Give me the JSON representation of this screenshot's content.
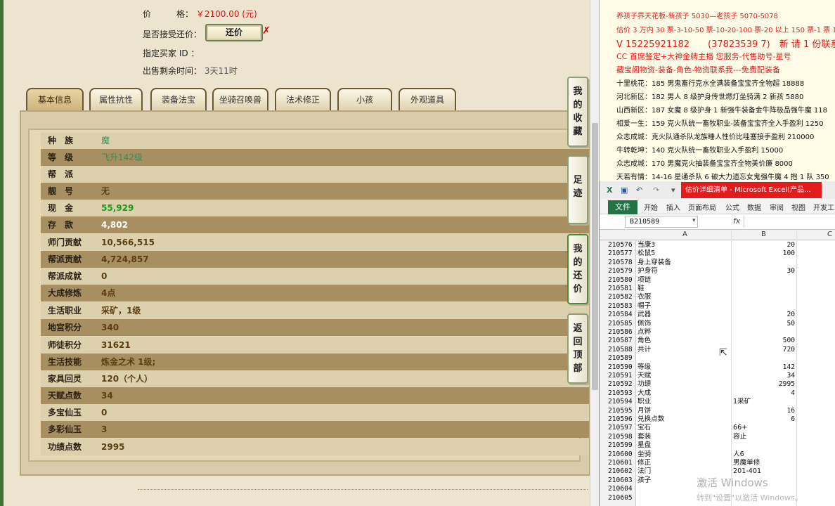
{
  "game": {
    "price_label": "价　　　格：",
    "price_value": "￥2100.00 (元)",
    "counter_label": "是否接受还价：",
    "counter_button": "还价",
    "buyer_label": "指定买家 ID ：",
    "time_label": "出售剩余时间：",
    "time_value": "3天11时",
    "tabs": [
      "基本信息",
      "属性抗性",
      "装备法宝",
      "坐骑召唤兽",
      "法术修正",
      "小孩",
      "外观道具"
    ],
    "stats": [
      {
        "k": "种　族",
        "v": "魔"
      },
      {
        "k": "等　级",
        "v": "飞升142级"
      },
      {
        "k": "帮　派",
        "v": ""
      },
      {
        "k": "靓　号",
        "v": "无"
      },
      {
        "k": "现　金",
        "v": "55,929"
      },
      {
        "k": "存　款",
        "v": "4,802"
      },
      {
        "k": "师门贡献",
        "v": "10,566,515"
      },
      {
        "k": "帮派贡献",
        "v": "4,724,857"
      },
      {
        "k": "帮派成就",
        "v": "0"
      },
      {
        "k": "大成修炼",
        "v": "4点"
      },
      {
        "k": "生活职业",
        "v": "采矿，1级"
      },
      {
        "k": "地宫积分",
        "v": "340"
      },
      {
        "k": "师徒积分",
        "v": "31621"
      },
      {
        "k": "生活技能",
        "v": "炼金之术 1级;"
      },
      {
        "k": "家具回灵",
        "v": "120（个人）"
      },
      {
        "k": "天赋点数",
        "v": "34"
      },
      {
        "k": "多宝仙玉",
        "v": "0"
      },
      {
        "k": "多彩仙玉",
        "v": "3"
      },
      {
        "k": "功绩点数",
        "v": "2995"
      }
    ],
    "side_buttons": [
      "我的收藏",
      "足迹",
      "我的还价",
      "返回顶部"
    ]
  },
  "doc": {
    "lines_red": [
      "养孩子界天花板-新孩子 5030—老孩子 5070-5078",
      "估价 3 万内 30 票-3-10-50 票-10-20-100 票-20 以上 150 票-1 票 1",
      "V 15225921182　　(37823539 7)　新 请 1 份联系",
      "CC 首席鉴定+大神金牌主播  您服务-代售助号-星号",
      "藏宝阁物资-装备-角色-物资联系我---免费配装备"
    ],
    "lines_black": [
      "十里桃花：185 男鬼畜行克水全满装备宝宝齐全物超 18888",
      "河北新区：182 男人 8 级护身传世燃灯坐骑满 2 新孩 5880",
      "山西新区：187 女魔 8 级护身 1 新强牛装备金牛阵极品强牛魔 118",
      "相爱一生：159 克火队统一畜牧职业-装备宝宝齐全入手盈利 1250",
      "众志成城：克火队通杀队龙族睡人性价比哇塞接手盈利 210000",
      "牛转乾坤：140 克火队统一畜牧职业入手盈利 15000",
      "众志成城：170 男魔克火抽装备宝宝齐全物美价廉 8000",
      "天若有情：14-16 星通杀队 6 破大力遗忘女鬼强牛魔 4 抱 1 队 350"
    ]
  },
  "excel": {
    "title": "估价详细清单 - Microsoft Excel(产品...",
    "file_tab": "文件",
    "ribbon_tabs": [
      "开始",
      "插入",
      "页面布局",
      "公式",
      "数据",
      "审阅",
      "视图",
      "开发工"
    ],
    "namebox": "B210589",
    "fx": "fx",
    "columns": [
      "A",
      "B",
      "C"
    ],
    "rows": [
      {
        "n": "210576",
        "a": "当康3",
        "b": "20"
      },
      {
        "n": "210577",
        "a": "松鼠5",
        "b": "100"
      },
      {
        "n": "210578",
        "a": "身上穿装备",
        "b": ""
      },
      {
        "n": "210579",
        "a": "护身符",
        "b": "30"
      },
      {
        "n": "210580",
        "a": "项链",
        "b": ""
      },
      {
        "n": "210581",
        "a": "鞋",
        "b": ""
      },
      {
        "n": "210582",
        "a": "衣服",
        "b": ""
      },
      {
        "n": "210583",
        "a": "帽子",
        "b": ""
      },
      {
        "n": "210584",
        "a": "武器",
        "b": "20"
      },
      {
        "n": "210585",
        "a": "佩饰",
        "b": "50"
      },
      {
        "n": "210586",
        "a": "点粹",
        "b": ""
      },
      {
        "n": "210587",
        "a": "角色",
        "b": "500"
      },
      {
        "n": "210588",
        "a": "共计",
        "b": "720"
      },
      {
        "n": "210589",
        "a": "",
        "b": ""
      },
      {
        "n": "210590",
        "a": "等级",
        "b": "142"
      },
      {
        "n": "210591",
        "a": "天赋",
        "b": "34"
      },
      {
        "n": "210592",
        "a": "功绩",
        "b": "2995"
      },
      {
        "n": "210593",
        "a": "大成",
        "b": "4"
      },
      {
        "n": "210594",
        "a": "职业",
        "bl": "1采矿"
      },
      {
        "n": "210595",
        "a": "月饼",
        "b": "16"
      },
      {
        "n": "210596",
        "a": "兑换点数",
        "b": "6"
      },
      {
        "n": "210597",
        "a": "宝石",
        "bl": "66+"
      },
      {
        "n": "210598",
        "a": "套装",
        "bl": "容止"
      },
      {
        "n": "210599",
        "a": "星盘",
        "bl": ""
      },
      {
        "n": "210600",
        "a": "坐骑",
        "bl": "人6"
      },
      {
        "n": "210601",
        "a": "修正",
        "bl": "男魔单修"
      },
      {
        "n": "210602",
        "a": "法门",
        "bl": "201-401"
      },
      {
        "n": "210603",
        "a": "孩子",
        "bl": ""
      },
      {
        "n": "210604",
        "a": "",
        "b": ""
      },
      {
        "n": "210605",
        "a": "",
        "b": ""
      }
    ],
    "watermark": "激活 Windows",
    "watermark_sub": "转到\"设置\"以激活 Windows。"
  }
}
